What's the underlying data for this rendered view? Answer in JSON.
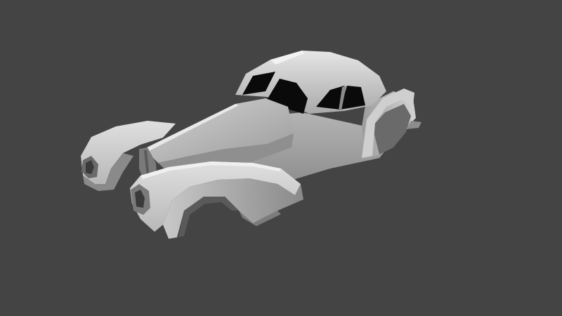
{
  "scene": {
    "subject": "car-body-model",
    "background_color": "#444444",
    "body_color": "#a8a8a8",
    "glass_color": "#0a0a0a"
  }
}
